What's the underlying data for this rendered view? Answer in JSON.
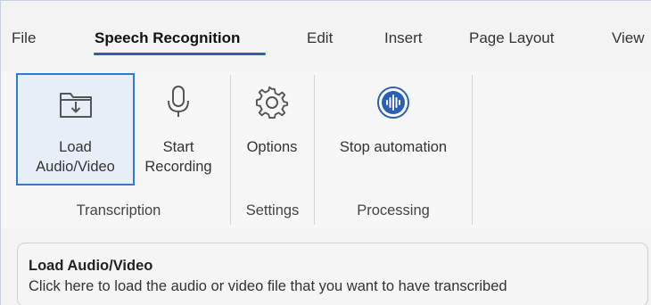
{
  "tabs": [
    {
      "label": "File"
    },
    {
      "label": "Speech Recognition"
    },
    {
      "label": "Edit"
    },
    {
      "label": "Insert"
    },
    {
      "label": "Page Layout"
    },
    {
      "label": "View"
    }
  ],
  "active_tab": "Speech Recognition",
  "ribbon": {
    "groups": [
      {
        "label": "Transcription"
      },
      {
        "label": "Settings"
      },
      {
        "label": "Processing"
      }
    ],
    "buttons": {
      "load": {
        "line1": "Load",
        "line2": "Audio/Video",
        "icon": "folder-download-icon"
      },
      "record": {
        "line1": "Start",
        "line2": "Recording",
        "icon": "microphone-icon"
      },
      "options": {
        "line1": "Options",
        "icon": "gear-icon"
      },
      "stop": {
        "line1": "Stop automation",
        "icon": "audio-wave-icon"
      }
    }
  },
  "tooltip": {
    "title": "Load Audio/Video",
    "text": "Click here to load the audio or video file that you want to have transcribed"
  },
  "colors": {
    "accent": "#2b5fb5",
    "selection_border": "#2e7bd6"
  }
}
